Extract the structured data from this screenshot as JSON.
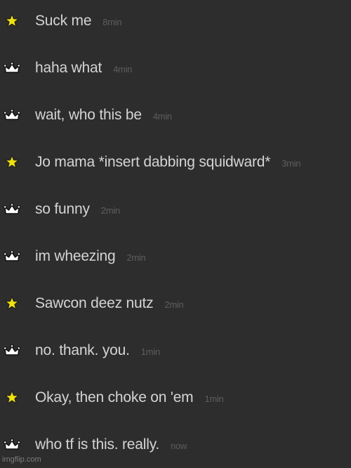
{
  "messages": [
    {
      "icon": "star-icon",
      "text": "Suck me",
      "time": "8min"
    },
    {
      "icon": "crown-icon",
      "text": "haha what",
      "time": "4min"
    },
    {
      "icon": "crown-icon",
      "text": "wait, who this be",
      "time": "4min"
    },
    {
      "icon": "star-icon",
      "text": "Jo mama *insert dabbing squidward*",
      "time": "3min"
    },
    {
      "icon": "crown-icon",
      "text": "so funny",
      "time": "2min"
    },
    {
      "icon": "crown-icon",
      "text": "im wheezing",
      "time": "2min"
    },
    {
      "icon": "star-icon",
      "text": "Sawcon deez nutz",
      "time": "2min"
    },
    {
      "icon": "crown-icon",
      "text": "no. thank. you.",
      "time": "1min"
    },
    {
      "icon": "star-icon",
      "text": "Okay, then choke on 'em",
      "time": "1min"
    },
    {
      "icon": "crown-icon",
      "text": "who tf is this. really.",
      "time": "now"
    }
  ],
  "colors": {
    "background": "#2d2d2d",
    "message_text": "#d4d4d4",
    "timestamp": "#5e5e5e",
    "star_fill": "#f0e010",
    "crown_fill": "#ffffff"
  },
  "watermark": "imgflip.com"
}
